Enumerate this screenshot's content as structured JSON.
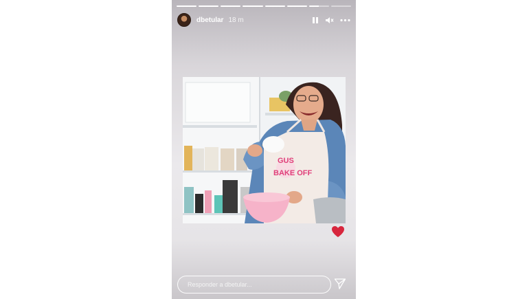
{
  "story": {
    "username": "dbetular",
    "time": "18 m",
    "progress": {
      "segments": 8,
      "completed": 6,
      "current_fill": 0.5
    },
    "icons": {
      "pause": "pause-icon",
      "volume": "volume-icon",
      "more": "more-options-icon",
      "like": "heart-icon",
      "send": "send-icon"
    },
    "photo": {
      "apron_lines": [
        "GUS",
        "BAKE OFF"
      ]
    },
    "reply": {
      "placeholder": "Responder a dbetular..."
    },
    "colors": {
      "heart": "#d7263d",
      "apron_text": "#e0407a"
    }
  }
}
